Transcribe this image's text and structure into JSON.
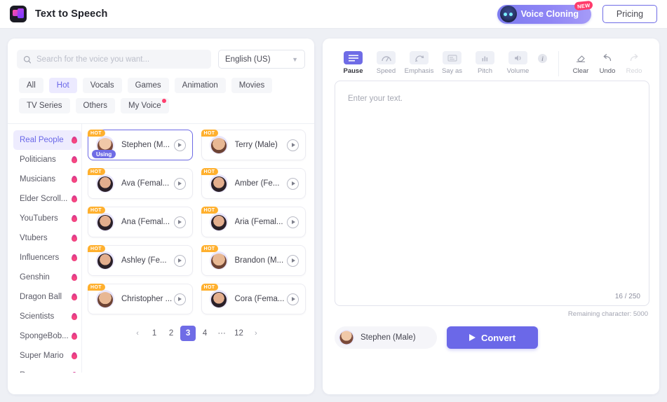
{
  "header": {
    "logo_icon": "app-logo-icon",
    "title": "Text to Speech",
    "voice_cloning_label": "Voice Cloning",
    "new_badge": "NEW",
    "pricing_label": "Pricing",
    "accent_color": "#6f6ce6",
    "new_badge_color": "#ff3b6b"
  },
  "search": {
    "placeholder": "Search for the voice you want...",
    "value": "",
    "icon": "search-icon",
    "language": "English (US)",
    "chevron": "chevron-down-icon"
  },
  "chips": [
    {
      "label": "All",
      "active": false,
      "dot": false
    },
    {
      "label": "Hot",
      "active": true,
      "dot": false
    },
    {
      "label": "Vocals",
      "active": false,
      "dot": false
    },
    {
      "label": "Games",
      "active": false,
      "dot": false
    },
    {
      "label": "Animation",
      "active": false,
      "dot": false
    },
    {
      "label": "Movies",
      "active": false,
      "dot": false
    },
    {
      "label": "TV Series",
      "active": false,
      "dot": false
    },
    {
      "label": "Others",
      "active": false,
      "dot": false
    },
    {
      "label": "My Voice",
      "active": false,
      "dot": true
    }
  ],
  "categories": [
    {
      "label": "Real People",
      "active": true
    },
    {
      "label": "Politicians",
      "active": false
    },
    {
      "label": "Musicians",
      "active": false
    },
    {
      "label": "Elder Scroll...",
      "active": false
    },
    {
      "label": "YouTubers",
      "active": false
    },
    {
      "label": "Vtubers",
      "active": false
    },
    {
      "label": "Influencers",
      "active": false
    },
    {
      "label": "Genshin",
      "active": false
    },
    {
      "label": "Dragon Ball",
      "active": false
    },
    {
      "label": "Scientists",
      "active": false
    },
    {
      "label": "SpongeBob...",
      "active": false
    },
    {
      "label": "Super Mario",
      "active": false
    },
    {
      "label": "Rappers",
      "active": false
    }
  ],
  "voices": [
    {
      "name": "Stephen (M...",
      "hot": "HOT",
      "using": "Using",
      "selected": true,
      "avatar": "m1"
    },
    {
      "name": "Terry (Male)",
      "hot": "HOT",
      "using": "",
      "selected": false,
      "avatar": "m2"
    },
    {
      "name": "Ava (Femal...",
      "hot": "HOT",
      "using": "",
      "selected": false,
      "avatar": "f1"
    },
    {
      "name": "Amber (Fe...",
      "hot": "HOT",
      "using": "",
      "selected": false,
      "avatar": "f1"
    },
    {
      "name": "Ana (Femal...",
      "hot": "HOT",
      "using": "",
      "selected": false,
      "avatar": "f1"
    },
    {
      "name": "Aria (Femal...",
      "hot": "HOT",
      "using": "",
      "selected": false,
      "avatar": "f1"
    },
    {
      "name": "Ashley (Fe...",
      "hot": "HOT",
      "using": "",
      "selected": false,
      "avatar": "f1"
    },
    {
      "name": "Brandon (M...",
      "hot": "HOT",
      "using": "",
      "selected": false,
      "avatar": "m2"
    },
    {
      "name": "Christopher ...",
      "hot": "HOT",
      "using": "",
      "selected": false,
      "avatar": "m2"
    },
    {
      "name": "Cora (Fema...",
      "hot": "HOT",
      "using": "",
      "selected": false,
      "avatar": "f1"
    }
  ],
  "pagination": {
    "prev": "‹",
    "next": "›",
    "pages": [
      "1",
      "2",
      "3",
      "4",
      "···",
      "12"
    ],
    "current": "3"
  },
  "toolbar": {
    "tools": [
      {
        "label": "Pause",
        "icon": "pause-lines-icon",
        "active": true
      },
      {
        "label": "Speed",
        "icon": "speedometer-icon",
        "active": false
      },
      {
        "label": "Emphasis",
        "icon": "emphasis-arrows-icon",
        "active": false
      },
      {
        "label": "Say as",
        "icon": "say-as-icon",
        "active": false
      },
      {
        "label": "Pitch",
        "icon": "pitch-bars-icon",
        "active": false
      },
      {
        "label": "Volume",
        "icon": "volume-icon",
        "active": false
      }
    ],
    "info_icon": "info-icon",
    "actions": [
      {
        "label": "Clear",
        "icon": "eraser-icon",
        "disabled": false
      },
      {
        "label": "Undo",
        "icon": "undo-arrow-icon",
        "disabled": false
      },
      {
        "label": "Redo",
        "icon": "redo-arrow-icon",
        "disabled": true
      }
    ]
  },
  "editor": {
    "placeholder": "Enter your text.",
    "value": "",
    "counter": "16 / 250",
    "remaining": "Remaining character: 5000"
  },
  "footer": {
    "selected_voice": "Stephen (Male)",
    "convert_label": "Convert",
    "play_icon": "play-icon",
    "convert_color": "#6b68e8"
  }
}
